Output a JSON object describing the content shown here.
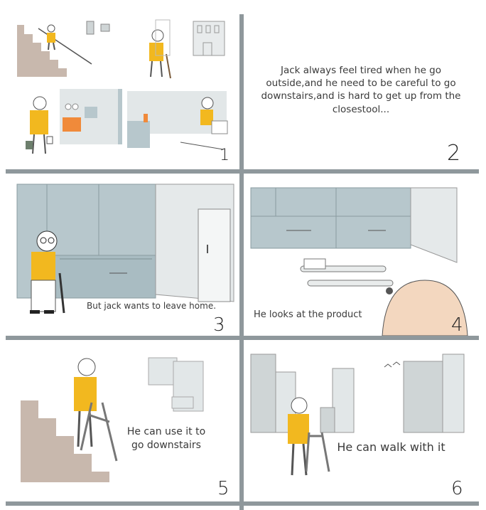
{
  "panels": [
    {
      "number": "1",
      "caption": ""
    },
    {
      "number": "2",
      "caption": "Jack always feel tired when he go outside,and he need to be careful to go downstairs,and is hard to get up from the closestool..."
    },
    {
      "number": "3",
      "caption": "But jack wants to leave home."
    },
    {
      "number": "4",
      "caption": "He looks at the product"
    },
    {
      "number": "5",
      "caption": "He can use it to go downstairs"
    },
    {
      "number": "6",
      "caption": "He can walk with it"
    }
  ],
  "colors": {
    "divider": "#8f989c",
    "yellow_shirt": "#f2b81f",
    "cabinet": "#b7c7cc",
    "stairs": "#c8b8ad",
    "building": "#cfd5d6",
    "bald_head": "#f3d7bf"
  }
}
